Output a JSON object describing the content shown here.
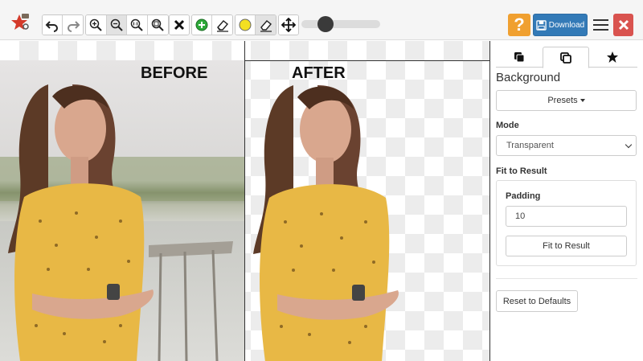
{
  "toolbar": {
    "download_label": "Download",
    "help_label": "?",
    "zoom_slider_fraction": 0.25
  },
  "canvas": {
    "before_label": "BEFORE",
    "after_label": "AFTER"
  },
  "panel": {
    "tabs": [
      {
        "icon": "layers-icon"
      },
      {
        "icon": "copy-icon",
        "active": true
      },
      {
        "icon": "star-icon"
      }
    ],
    "title": "Background",
    "presets_label": "Presets",
    "mode_label": "Mode",
    "mode_value": "Transparent",
    "fit_label": "Fit to Result",
    "padding_label": "Padding",
    "padding_value": "10",
    "fit_button": "Fit to Result",
    "reset_button": "Reset to Defaults"
  },
  "colors": {
    "download": "#337ab7",
    "help": "#f0a030",
    "close": "#d9534f",
    "dress": "#e8b845"
  }
}
